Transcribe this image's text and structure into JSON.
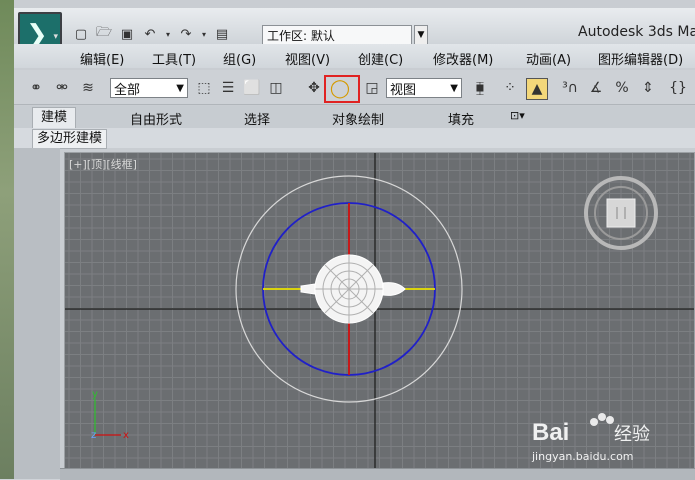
{
  "app": {
    "title": "Autodesk 3ds Ma"
  },
  "quick_access": {
    "workspace_label": "工作区: 默认",
    "icons": [
      "new-file-icon",
      "open-folder-icon",
      "save-icon",
      "undo-icon",
      "redo-icon",
      "project-folder-icon"
    ]
  },
  "menus": [
    "编辑(E)",
    "工具(T)",
    "组(G)",
    "视图(V)",
    "创建(C)",
    "修改器(M)",
    "动画(A)",
    "图形编辑器(D)"
  ],
  "toolbar": {
    "selection_filter": "全部",
    "reference_coord": "视图",
    "highlighted_tool": "rotate-icon"
  },
  "ribbon": {
    "tabs": [
      "建模",
      "自由形式",
      "选择",
      "对象绘制",
      "填充"
    ],
    "active_tab": "建模",
    "panel": "多边形建模"
  },
  "viewport": {
    "label": "[+][顶][线框]",
    "gizmo": "rotate-gizmo",
    "object": "teapot",
    "view_cube": "view-cube"
  },
  "colors": {
    "grid_bg": "#6b6e71",
    "grid_line": "#7c7f82",
    "blue_ring": "#2020c8",
    "red_axis": "#d01010",
    "yellow_axis": "#e8e000",
    "highlight": "#e02222"
  },
  "watermark": {
    "brand": "Bai",
    "suffix": "经验",
    "url": "jingyan.baidu.com"
  }
}
